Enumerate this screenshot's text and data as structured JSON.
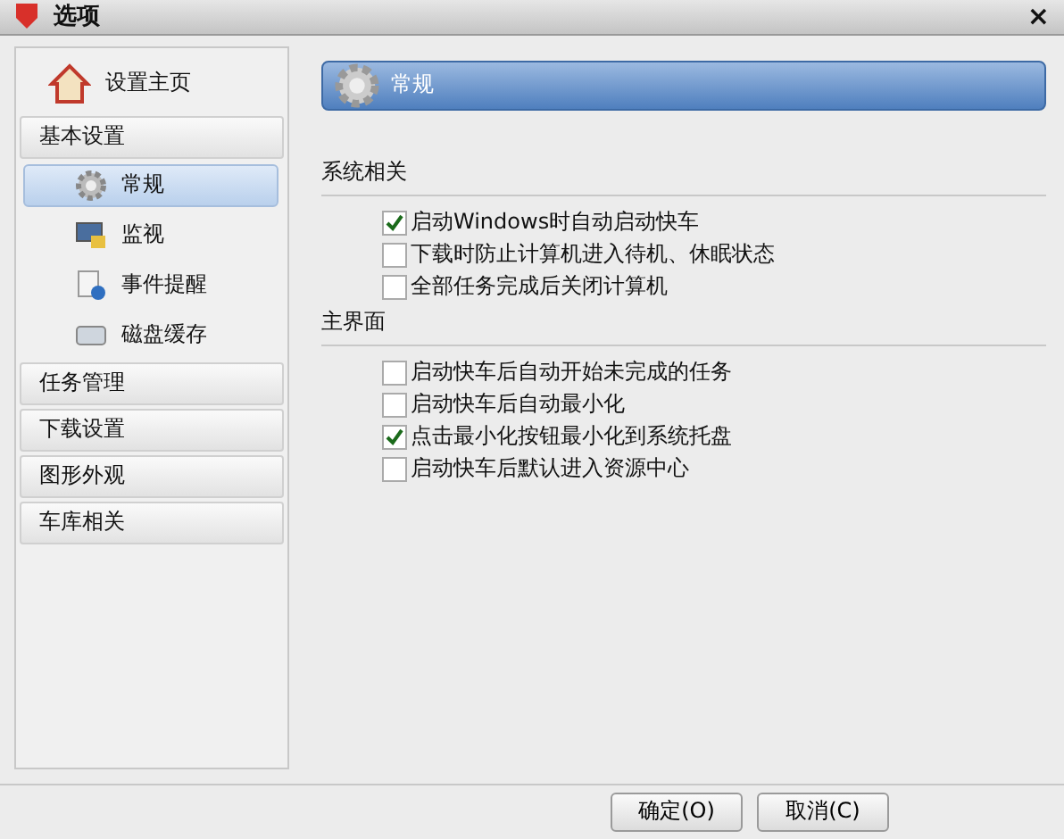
{
  "window": {
    "title": "选项",
    "close": "×"
  },
  "sidebar": {
    "home": "设置主页",
    "groups": [
      {
        "label": "基本设置",
        "children": [
          {
            "label": "常规",
            "selected": true
          },
          {
            "label": "监视",
            "selected": false
          },
          {
            "label": "事件提醒",
            "selected": false
          },
          {
            "label": "磁盘缓存",
            "selected": false
          }
        ]
      },
      {
        "label": "任务管理"
      },
      {
        "label": "下载设置"
      },
      {
        "label": "图形外观"
      },
      {
        "label": "车库相关"
      }
    ]
  },
  "panel": {
    "title": "常规",
    "sections": [
      {
        "title": "系统相关",
        "options": [
          {
            "label": "启动Windows时自动启动快车",
            "checked": true
          },
          {
            "label": "下载时防止计算机进入待机、休眠状态",
            "checked": false
          },
          {
            "label": "全部任务完成后关闭计算机",
            "checked": false
          }
        ]
      },
      {
        "title": "主界面",
        "options": [
          {
            "label": "启动快车后自动开始未完成的任务",
            "checked": false
          },
          {
            "label": "启动快车后自动最小化",
            "checked": false
          },
          {
            "label": "点击最小化按钮最小化到系统托盘",
            "checked": true
          },
          {
            "label": "启动快车后默认进入资源中心",
            "checked": false
          }
        ]
      }
    ]
  },
  "buttons": [
    "确定(O)",
    "取消(C)"
  ]
}
